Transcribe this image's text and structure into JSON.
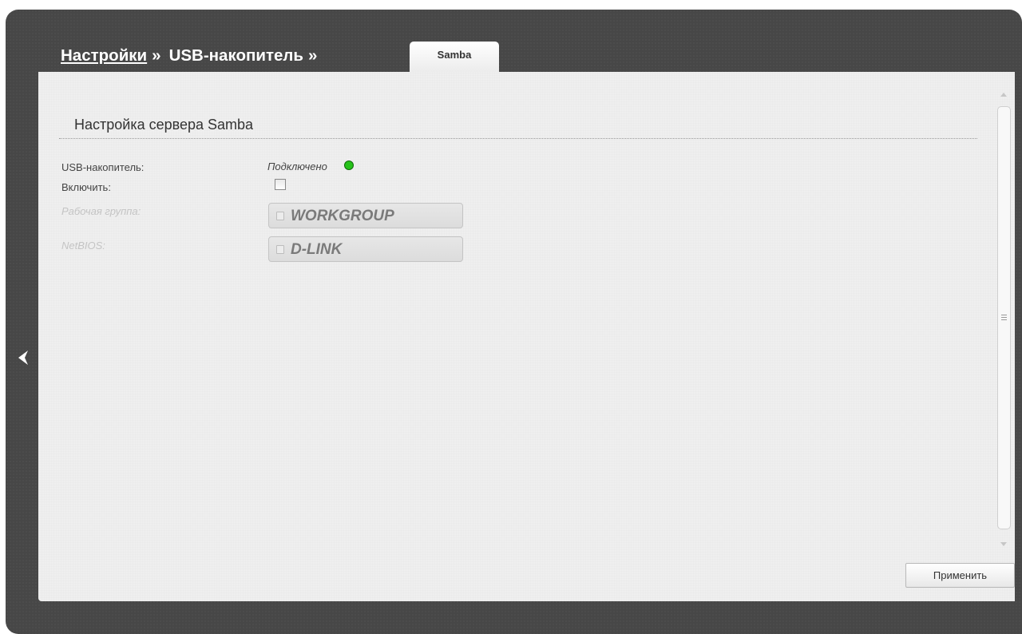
{
  "breadcrumb": {
    "items": [
      {
        "label": "Настройки"
      },
      {
        "label": "USB-накопитель"
      }
    ],
    "separator": "»",
    "active_tab": "Samba"
  },
  "section": {
    "title": "Настройка сервера Samba"
  },
  "form": {
    "usb": {
      "label": "USB-накопитель:",
      "status": "Подключено",
      "status_color": "#27c21a"
    },
    "enable": {
      "label": "Включить:",
      "checked": false
    },
    "workgroup": {
      "label": "Рабочая группа:",
      "value": "WORKGROUP"
    },
    "netbios": {
      "label": "NetBIOS:",
      "value": "D-LINK"
    }
  },
  "buttons": {
    "apply_label": "Применить"
  },
  "colors": {
    "frame": "#474747",
    "content": "#efefef"
  }
}
